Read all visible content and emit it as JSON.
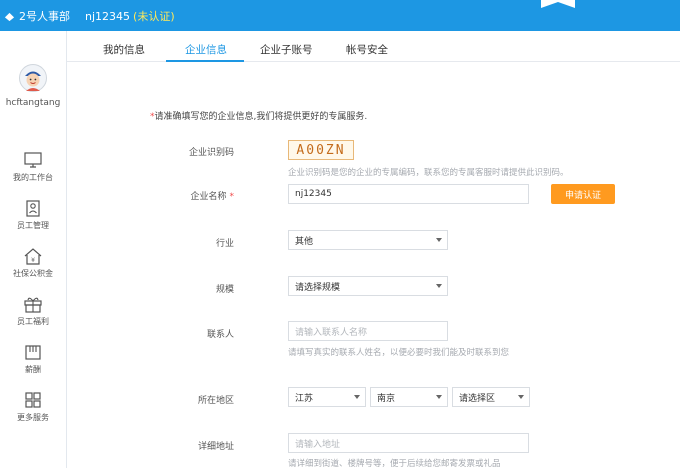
{
  "header": {
    "logo_text": "2号人事部",
    "account_name": "nj12345",
    "account_status": "(未认证)"
  },
  "sidebar": {
    "username": "hcftangtang",
    "items": [
      {
        "label": "我的工作台",
        "icon": "monitor-icon"
      },
      {
        "label": "员工管理",
        "icon": "employee-icon"
      },
      {
        "label": "社保公积金",
        "icon": "house-icon"
      },
      {
        "label": "员工福利",
        "icon": "gift-icon"
      },
      {
        "label": "薪酬",
        "icon": "salary-icon"
      },
      {
        "label": "更多服务",
        "icon": "grid-icon"
      }
    ]
  },
  "tabs": [
    {
      "label": "我的信息",
      "active": false
    },
    {
      "label": "企业信息",
      "active": true
    },
    {
      "label": "企业子账号",
      "active": false
    },
    {
      "label": "帐号安全",
      "active": false
    }
  ],
  "form": {
    "notice_star": "*",
    "notice": "请准确填写您的企业信息,我们将提供更好的专属服务.",
    "company_code": {
      "label": "企业识别码",
      "value": "A00ZN",
      "hint": "企业识别码是您的企业的专属编码，联系您的专属客服时请提供此识别码。"
    },
    "company_name": {
      "label": "企业名称",
      "required_mark": "*",
      "value": "nj12345",
      "action": "申请认证"
    },
    "industry": {
      "label": "行业",
      "value": "其他"
    },
    "scale": {
      "label": "规模",
      "value": "请选择规模"
    },
    "contact": {
      "label": "联系人",
      "placeholder": "请输入联系人名称",
      "hint": "请填写真实的联系人姓名，以便必要时我们能及时联系到您"
    },
    "region": {
      "label": "所在地区",
      "province": "江苏",
      "city": "南京",
      "district": "请选择区"
    },
    "address": {
      "label": "详细地址",
      "placeholder": "请输入地址",
      "hint": "请详细到街道、楼牌号等，便于后续给您邮寄发票或礼品"
    }
  },
  "colors": {
    "brand_blue": "#1d97e3",
    "accent_orange": "#ff9a1f",
    "status_yellow": "#ffe95a",
    "code_orange": "#c46b1a"
  }
}
